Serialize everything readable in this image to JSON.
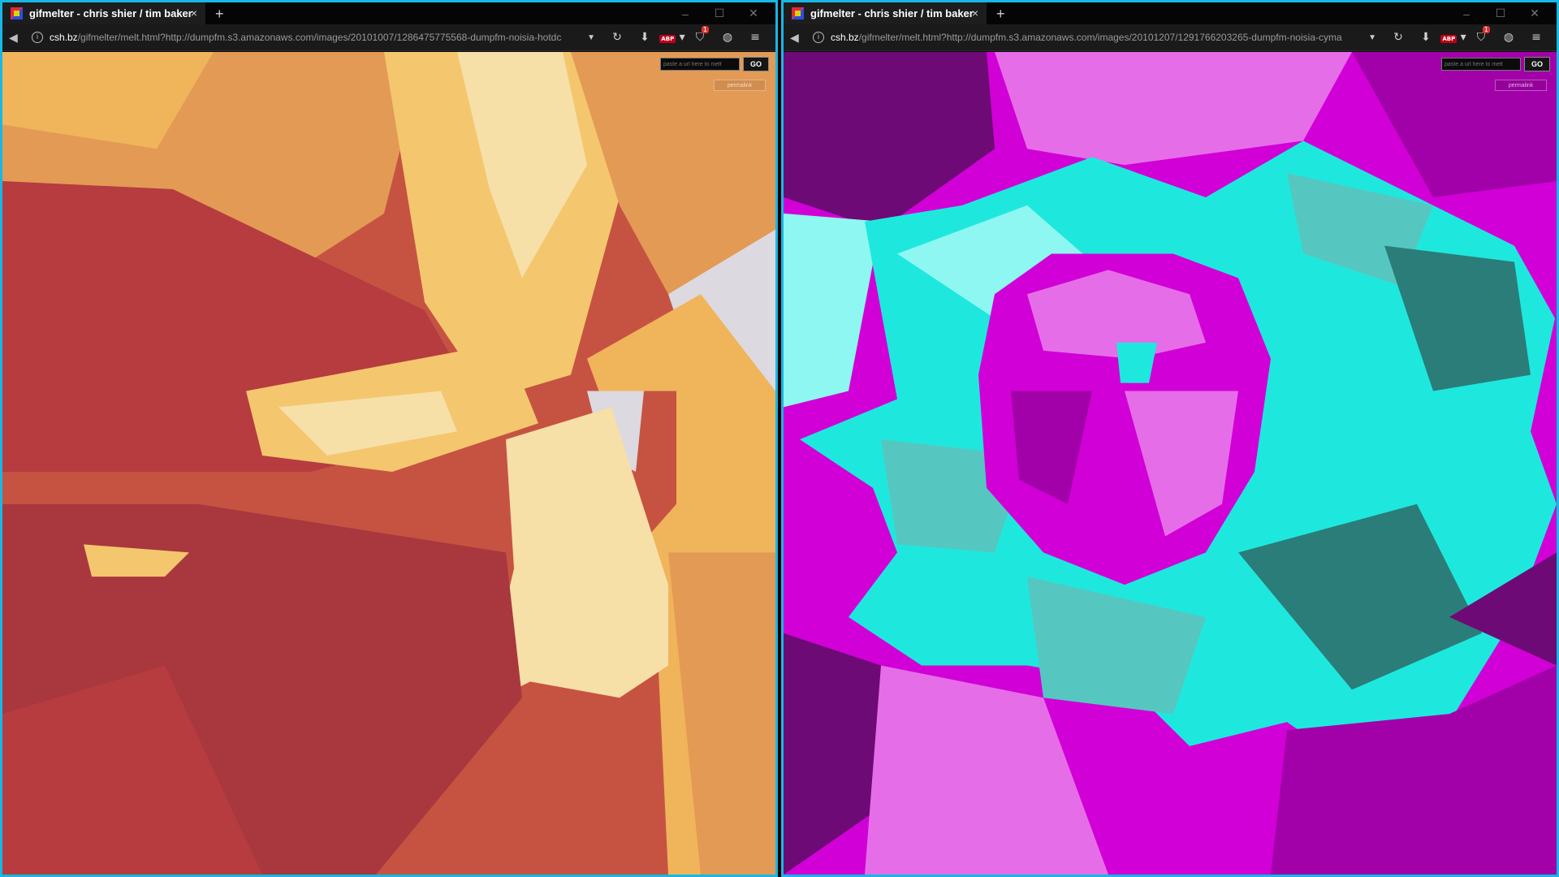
{
  "windows": [
    {
      "tab_title": "gifmelter - chris shier / tim baker",
      "url_domain": "csh.bz",
      "url_path": "/gifmelter/melt.html?http://dumpfm.s3.amazonaws.com/images/20101007/1286475775568-dumpfm-noisia-hotdc",
      "input_placeholder": "paste a url here to melt",
      "go_label": "GO",
      "share_label": "permalink",
      "extension_badge": "1",
      "abp_label": "ABP",
      "palette": [
        "#c65342",
        "#e39a55",
        "#f4c66e",
        "#f7dfa8",
        "#b63c3f",
        "#dcd9e0",
        "#a8383d",
        "#f0b45b"
      ]
    },
    {
      "tab_title": "gifmelter - chris shier / tim baker",
      "url_domain": "csh.bz",
      "url_path": "/gifmelter/melt.html?http://dumpfm.s3.amazonaws.com/images/20101207/1291766203265-dumpfm-noisia-cyma",
      "input_placeholder": "paste a url here to melt",
      "go_label": "GO",
      "share_label": "permalink",
      "extension_badge": "1",
      "abp_label": "ABP",
      "palette": [
        "#d100d6",
        "#1ee8de",
        "#6d0a76",
        "#55c7c0",
        "#e66de8",
        "#2b7d79",
        "#a200a8",
        "#8ef7f1"
      ]
    }
  ],
  "window_controls": [
    "–",
    "☐",
    "✕"
  ],
  "frame_color": "#17b7e6"
}
